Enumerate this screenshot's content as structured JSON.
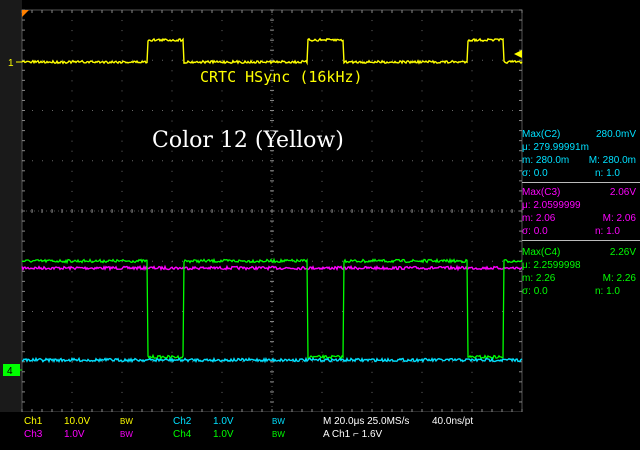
{
  "annotations": {
    "hsync": "CRTC HSync (16kHz)",
    "color": "Color 12 (Yellow)"
  },
  "markers": {
    "ch1": "1",
    "ch4": "4"
  },
  "measurements": {
    "c2": {
      "title": "Max(C2)",
      "value": "280.0mV",
      "mu": "μ: 279.99991m",
      "m1": "m: 280.0m",
      "m2": "M: 280.0m",
      "sigma": "σ: 0.0",
      "n": "n: 1.0"
    },
    "c3": {
      "title": "Max(C3)",
      "value": "2.06V",
      "mu": "μ: 2.0599999",
      "m1": "m: 2.06",
      "m2": "M: 2.06",
      "sigma": "σ: 0.0",
      "n": "n: 1.0"
    },
    "c4": {
      "title": "Max(C4)",
      "value": "2.26V",
      "mu": "μ: 2.2599998",
      "m1": "m: 2.26",
      "m2": "M: 2.26",
      "sigma": "σ: 0.0",
      "n": "n: 1.0"
    }
  },
  "status": {
    "ch1_label": "Ch1",
    "ch1_scale": "10.0V",
    "ch1_bw": "BW",
    "ch2_label": "Ch2",
    "ch2_scale": "1.0V",
    "ch2_bw": "BW",
    "ch3_label": "Ch3",
    "ch3_scale": "1.0V",
    "ch3_bw": "BW",
    "ch4_label": "Ch4",
    "ch4_scale": "1.0V",
    "ch4_bw": "BW",
    "timebase": "M 20.0μs 25.0MS/s",
    "record": "40.0ns/pt",
    "trigger": "A  Ch1  ⌐  1.6V"
  },
  "colors": {
    "ch1": "#ffff00",
    "ch2": "#00e0ff",
    "ch3": "#ff00ff",
    "ch4": "#00ff00",
    "trigger_marker": "#ff8000"
  }
}
